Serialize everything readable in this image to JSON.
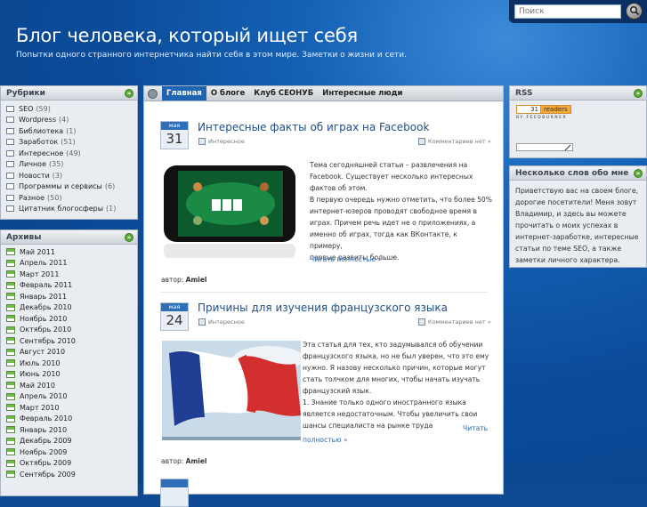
{
  "header": {
    "title": "Блог человека, который ищет себя",
    "subtitle": "Попытки одного странного интернетчика найти себя в этом мире. Заметки о жизни и сети."
  },
  "search": {
    "placeholder": "Поиск"
  },
  "rubrics": {
    "title": "Рубрики",
    "items": [
      {
        "label": "SEO",
        "count": "(59)"
      },
      {
        "label": "Wordpress",
        "count": "(4)"
      },
      {
        "label": "Библиотека",
        "count": "(1)"
      },
      {
        "label": "Заработок",
        "count": "(51)"
      },
      {
        "label": "Интересное",
        "count": "(49)"
      },
      {
        "label": "Личное",
        "count": "(35)"
      },
      {
        "label": "Новости",
        "count": "(3)"
      },
      {
        "label": "Программы и сервисы",
        "count": "(6)"
      },
      {
        "label": "Разное",
        "count": "(50)"
      },
      {
        "label": "Цитатник блогосферы",
        "count": "(1)"
      }
    ]
  },
  "archives": {
    "title": "Архивы",
    "items": [
      "Май 2011",
      "Апрель 2011",
      "Март 2011",
      "Февраль 2011",
      "Январь 2011",
      "Декабрь 2010",
      "Ноябрь 2010",
      "Октябрь 2010",
      "Сентябрь 2010",
      "Август 2010",
      "Июль 2010",
      "Июнь 2010",
      "Май 2010",
      "Апрель 2010",
      "Март 2010",
      "Февраль 2010",
      "Январь 2010",
      "Декабрь 2009",
      "Ноябрь 2009",
      "Октябрь 2009",
      "Сентябрь 2009"
    ]
  },
  "nav": {
    "tabs": [
      "Главная",
      "О блоге",
      "Клуб СЕОНУБ",
      "Интересные люди"
    ]
  },
  "posts": [
    {
      "month": "мая",
      "day": "31",
      "title": "Интересные факты об играх на Facebook",
      "category": "Интересное",
      "comments": "Комментариев нет »",
      "lines": [
        "Тема сегодняшней статьи – развлечения на",
        "Facebook. Существует несколько интересных",
        "фактов об этом.",
        "В первую очередь нужно отметить, что более 50%",
        "интернет-юзеров проводят свободное время в",
        "играх. Причем речь идет не о приложениях, а",
        "именно об играх, тогда как ВКонтакте, к примеру,",
        "первые развиты больше."
      ],
      "more": "Читать полностью »",
      "author_label": "автор:",
      "author": "Amiel"
    },
    {
      "month": "мая",
      "day": "24",
      "title": "Причины для изучения французского языка",
      "category": "Интересное",
      "comments": "Комментариев нет »",
      "lines": [
        "Эта статья для тех, кто задумывался об обучении",
        "французского языка, но не был уверен, что это ему",
        "нужно. Я назову несколько причин, которые могут",
        "стать толчком для многих, чтобы начать изучать",
        "французский язык.",
        "1. Знание только одного иностранного языка",
        "является недостаточным. Чтобы увеличить свои",
        "шансы специалиста на рынке труда"
      ],
      "more_a": "Читать",
      "more_b": "полностью »",
      "author_label": "автор:",
      "author": "Amiel"
    }
  ],
  "rss": {
    "title": "RSS",
    "readers_count": "31",
    "readers_label": "readers",
    "feedburner": "BY FEEDBURNER"
  },
  "about": {
    "title": "Несколько слов обо мне",
    "text": "Приветствую вас на своем блоге, дорогие посетители! Меня зовут Владимир, и здесь вы можете прочитать о моих успехах в интернет-заработке, интересные статьи по теме SEO, а также заметки личного характера."
  }
}
